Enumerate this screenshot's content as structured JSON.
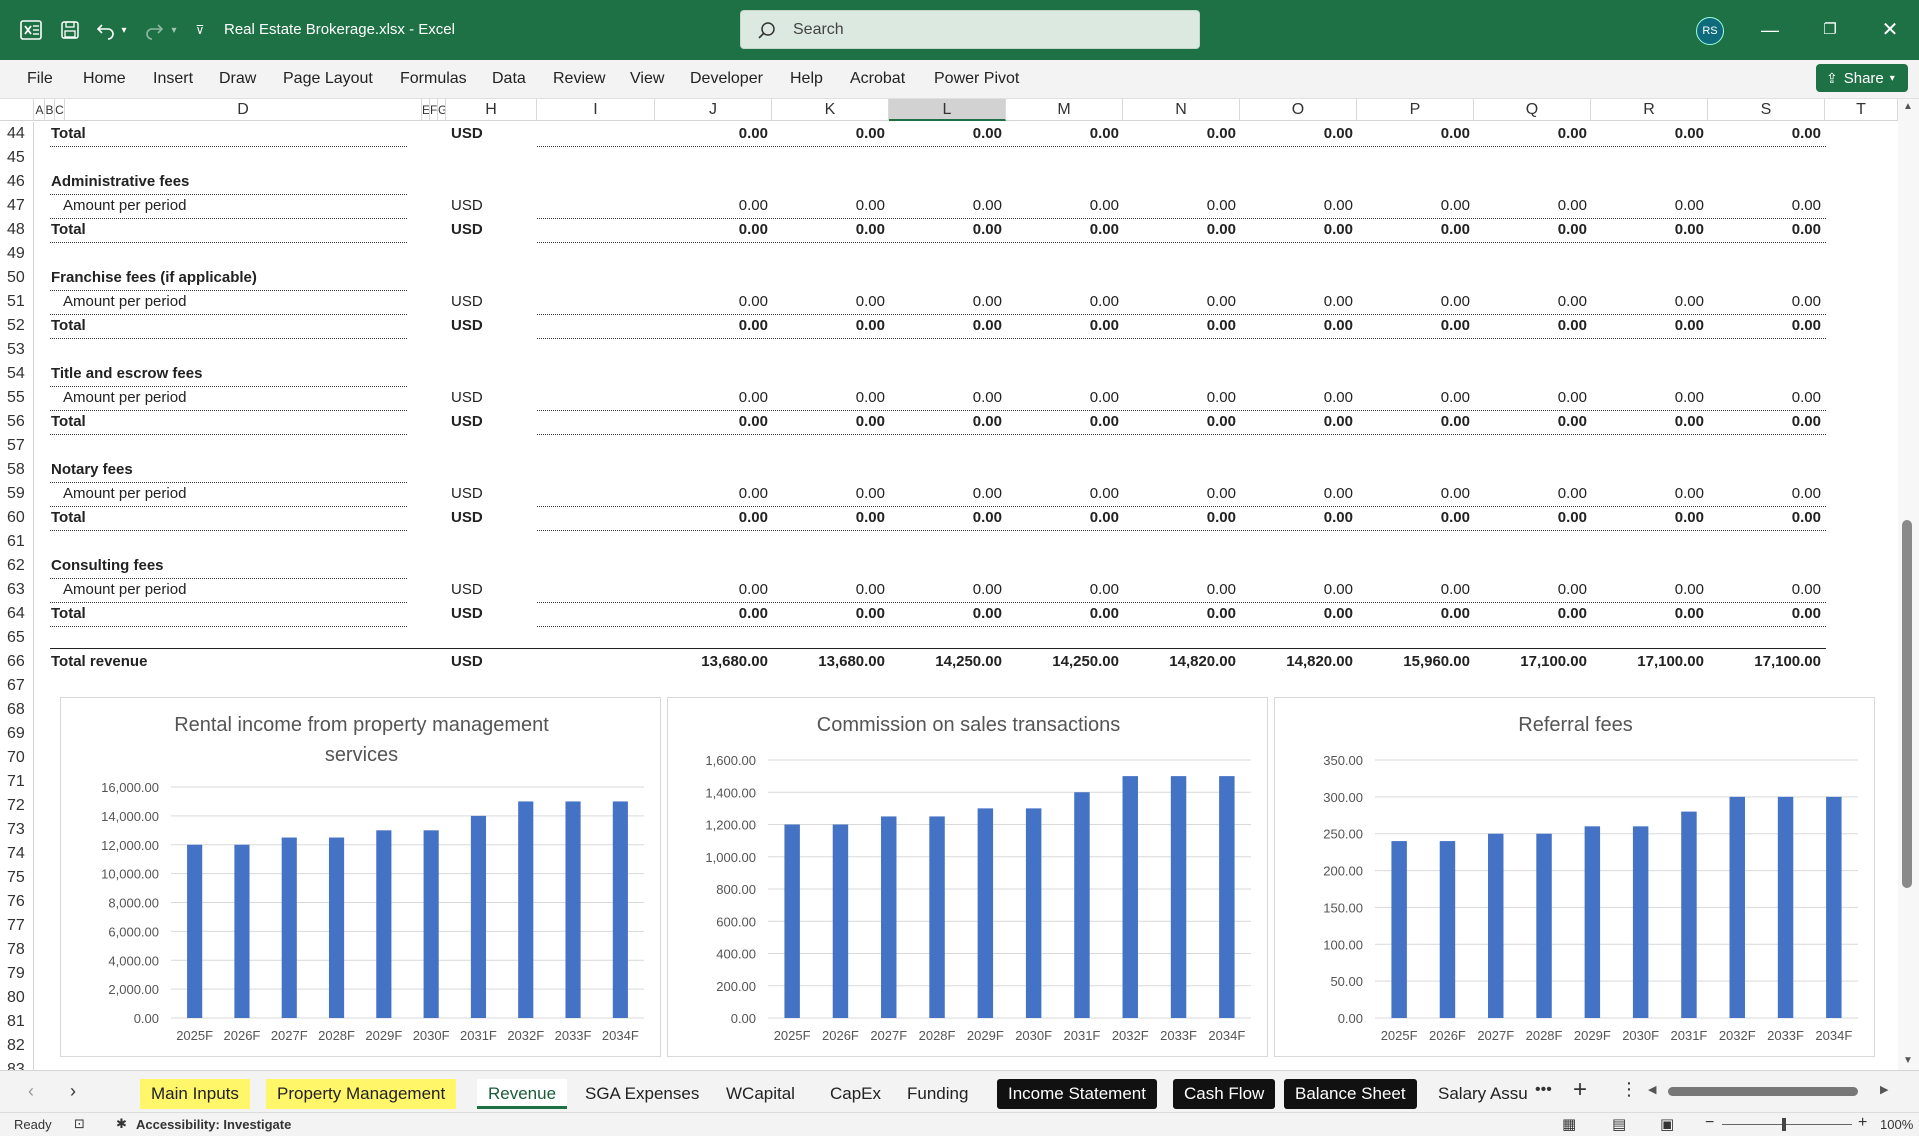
{
  "window": {
    "doc_title": "Real Estate Brokerage.xlsx  -  Excel",
    "search_placeholder": "Search",
    "avatar_initials": "RS"
  },
  "menu": [
    "File",
    "Home",
    "Insert",
    "Draw",
    "Page Layout",
    "Formulas",
    "Data",
    "Review",
    "View",
    "Developer",
    "Help",
    "Acrobat",
    "Power Pivot"
  ],
  "share_label": "Share",
  "columns": [
    {
      "label": "A"
    },
    {
      "label": "B"
    },
    {
      "label": "C"
    },
    {
      "label": "D"
    },
    {
      "label": "E"
    },
    {
      "label": "F"
    },
    {
      "label": "G"
    },
    {
      "label": "H"
    },
    {
      "label": "I"
    },
    {
      "label": "J"
    },
    {
      "label": "K"
    },
    {
      "label": "L"
    },
    {
      "label": "M"
    },
    {
      "label": "N"
    },
    {
      "label": "O"
    },
    {
      "label": "P"
    },
    {
      "label": "Q"
    },
    {
      "label": "R"
    },
    {
      "label": "S"
    },
    {
      "label": "T"
    }
  ],
  "rows": [
    "44",
    "45",
    "46",
    "47",
    "48",
    "49",
    "50",
    "51",
    "52",
    "53",
    "54",
    "55",
    "56",
    "57",
    "58",
    "59",
    "60",
    "61",
    "62",
    "63",
    "64",
    "65",
    "66",
    "67",
    "68",
    "69",
    "70",
    "71",
    "72",
    "73",
    "74",
    "75",
    "76",
    "77",
    "78",
    "79",
    "80",
    "81",
    "82",
    "83"
  ],
  "sheet": [
    {
      "row": "44",
      "label": "Total",
      "style": "total",
      "unit": "USD",
      "values": [
        "0.00",
        "0.00",
        "0.00",
        "0.00",
        "0.00",
        "0.00",
        "0.00",
        "0.00",
        "0.00",
        "0.00"
      ]
    },
    {
      "row": "46",
      "label": "Administrative fees",
      "style": "header"
    },
    {
      "row": "47",
      "label": "Amount per period",
      "style": "item",
      "unit": "USD",
      "values": [
        "0.00",
        "0.00",
        "0.00",
        "0.00",
        "0.00",
        "0.00",
        "0.00",
        "0.00",
        "0.00",
        "0.00"
      ]
    },
    {
      "row": "48",
      "label": "Total",
      "style": "total",
      "unit": "USD",
      "values": [
        "0.00",
        "0.00",
        "0.00",
        "0.00",
        "0.00",
        "0.00",
        "0.00",
        "0.00",
        "0.00",
        "0.00"
      ]
    },
    {
      "row": "50",
      "label": "Franchise fees (if applicable)",
      "style": "header"
    },
    {
      "row": "51",
      "label": "Amount per period",
      "style": "item",
      "unit": "USD",
      "values": [
        "0.00",
        "0.00",
        "0.00",
        "0.00",
        "0.00",
        "0.00",
        "0.00",
        "0.00",
        "0.00",
        "0.00"
      ]
    },
    {
      "row": "52",
      "label": "Total",
      "style": "total",
      "unit": "USD",
      "values": [
        "0.00",
        "0.00",
        "0.00",
        "0.00",
        "0.00",
        "0.00",
        "0.00",
        "0.00",
        "0.00",
        "0.00"
      ]
    },
    {
      "row": "54",
      "label": "Title and escrow fees",
      "style": "header"
    },
    {
      "row": "55",
      "label": "Amount per period",
      "style": "item",
      "unit": "USD",
      "values": [
        "0.00",
        "0.00",
        "0.00",
        "0.00",
        "0.00",
        "0.00",
        "0.00",
        "0.00",
        "0.00",
        "0.00"
      ]
    },
    {
      "row": "56",
      "label": "Total",
      "style": "total",
      "unit": "USD",
      "values": [
        "0.00",
        "0.00",
        "0.00",
        "0.00",
        "0.00",
        "0.00",
        "0.00",
        "0.00",
        "0.00",
        "0.00"
      ]
    },
    {
      "row": "58",
      "label": "Notary fees",
      "style": "header"
    },
    {
      "row": "59",
      "label": "Amount per period",
      "style": "item",
      "unit": "USD",
      "values": [
        "0.00",
        "0.00",
        "0.00",
        "0.00",
        "0.00",
        "0.00",
        "0.00",
        "0.00",
        "0.00",
        "0.00"
      ]
    },
    {
      "row": "60",
      "label": "Total",
      "style": "total",
      "unit": "USD",
      "values": [
        "0.00",
        "0.00",
        "0.00",
        "0.00",
        "0.00",
        "0.00",
        "0.00",
        "0.00",
        "0.00",
        "0.00"
      ]
    },
    {
      "row": "62",
      "label": "Consulting fees",
      "style": "header"
    },
    {
      "row": "63",
      "label": "Amount per period",
      "style": "item",
      "unit": "USD",
      "values": [
        "0.00",
        "0.00",
        "0.00",
        "0.00",
        "0.00",
        "0.00",
        "0.00",
        "0.00",
        "0.00",
        "0.00"
      ]
    },
    {
      "row": "64",
      "label": "Total",
      "style": "total",
      "unit": "USD",
      "values": [
        "0.00",
        "0.00",
        "0.00",
        "0.00",
        "0.00",
        "0.00",
        "0.00",
        "0.00",
        "0.00",
        "0.00"
      ]
    },
    {
      "row": "66",
      "label": "Total revenue",
      "style": "grand",
      "unit": "USD",
      "values": [
        "13,680.00",
        "13,680.00",
        "14,250.00",
        "14,250.00",
        "14,820.00",
        "14,820.00",
        "15,960.00",
        "17,100.00",
        "17,100.00",
        "17,100.00"
      ]
    }
  ],
  "chart_data": [
    {
      "type": "bar",
      "title": "Rental income from property management services",
      "title_lines": [
        "Rental income from property management",
        "services"
      ],
      "categories": [
        "2025F",
        "2026F",
        "2027F",
        "2028F",
        "2029F",
        "2030F",
        "2031F",
        "2032F",
        "2033F",
        "2034F"
      ],
      "values": [
        12000,
        12000,
        12500,
        12500,
        13000,
        13000,
        14000,
        15000,
        15000,
        15000
      ],
      "ylim": [
        0,
        16000
      ],
      "yticks": [
        "0.00",
        "2,000.00",
        "4,000.00",
        "6,000.00",
        "8,000.00",
        "10,000.00",
        "12,000.00",
        "14,000.00",
        "16,000.00"
      ],
      "color": "#4472c4",
      "grid": true
    },
    {
      "type": "bar",
      "title": "Commission on sales transactions",
      "title_lines": [
        "Commission on sales transactions"
      ],
      "categories": [
        "2025F",
        "2026F",
        "2027F",
        "2028F",
        "2029F",
        "2030F",
        "2031F",
        "2032F",
        "2033F",
        "2034F"
      ],
      "values": [
        1200,
        1200,
        1250,
        1250,
        1300,
        1300,
        1400,
        1500,
        1500,
        1500
      ],
      "ylim": [
        0,
        1600
      ],
      "yticks": [
        "0.00",
        "200.00",
        "400.00",
        "600.00",
        "800.00",
        "1,000.00",
        "1,200.00",
        "1,400.00",
        "1,600.00"
      ],
      "color": "#4472c4",
      "grid": true
    },
    {
      "type": "bar",
      "title": "Referral fees",
      "title_lines": [
        "Referral fees"
      ],
      "categories": [
        "2025F",
        "2026F",
        "2027F",
        "2028F",
        "2029F",
        "2030F",
        "2031F",
        "2032F",
        "2033F",
        "2034F"
      ],
      "values": [
        240,
        240,
        250,
        250,
        260,
        260,
        280,
        300,
        300,
        300
      ],
      "ylim": [
        0,
        350
      ],
      "yticks": [
        "0.00",
        "50.00",
        "100.00",
        "150.00",
        "200.00",
        "250.00",
        "300.00",
        "350.00"
      ],
      "color": "#4472c4",
      "grid": true
    }
  ],
  "tabs": [
    {
      "label": "Main Inputs",
      "style": "yellow"
    },
    {
      "label": "Property Management",
      "style": "yellow"
    },
    {
      "label": "Revenue",
      "style": "active"
    },
    {
      "label": "SGA Expenses",
      "style": "plain"
    },
    {
      "label": "WCapital",
      "style": "plain"
    },
    {
      "label": "CapEx",
      "style": "plain"
    },
    {
      "label": "Funding",
      "style": "plain"
    },
    {
      "label": "Income Statement",
      "style": "black"
    },
    {
      "label": "Cash Flow",
      "style": "black"
    },
    {
      "label": "Balance Sheet",
      "style": "black"
    },
    {
      "label": "Salary Assu",
      "style": "plain"
    }
  ],
  "status": {
    "ready": "Ready",
    "accessibility": "Accessibility: Investigate",
    "zoom": "100%"
  }
}
